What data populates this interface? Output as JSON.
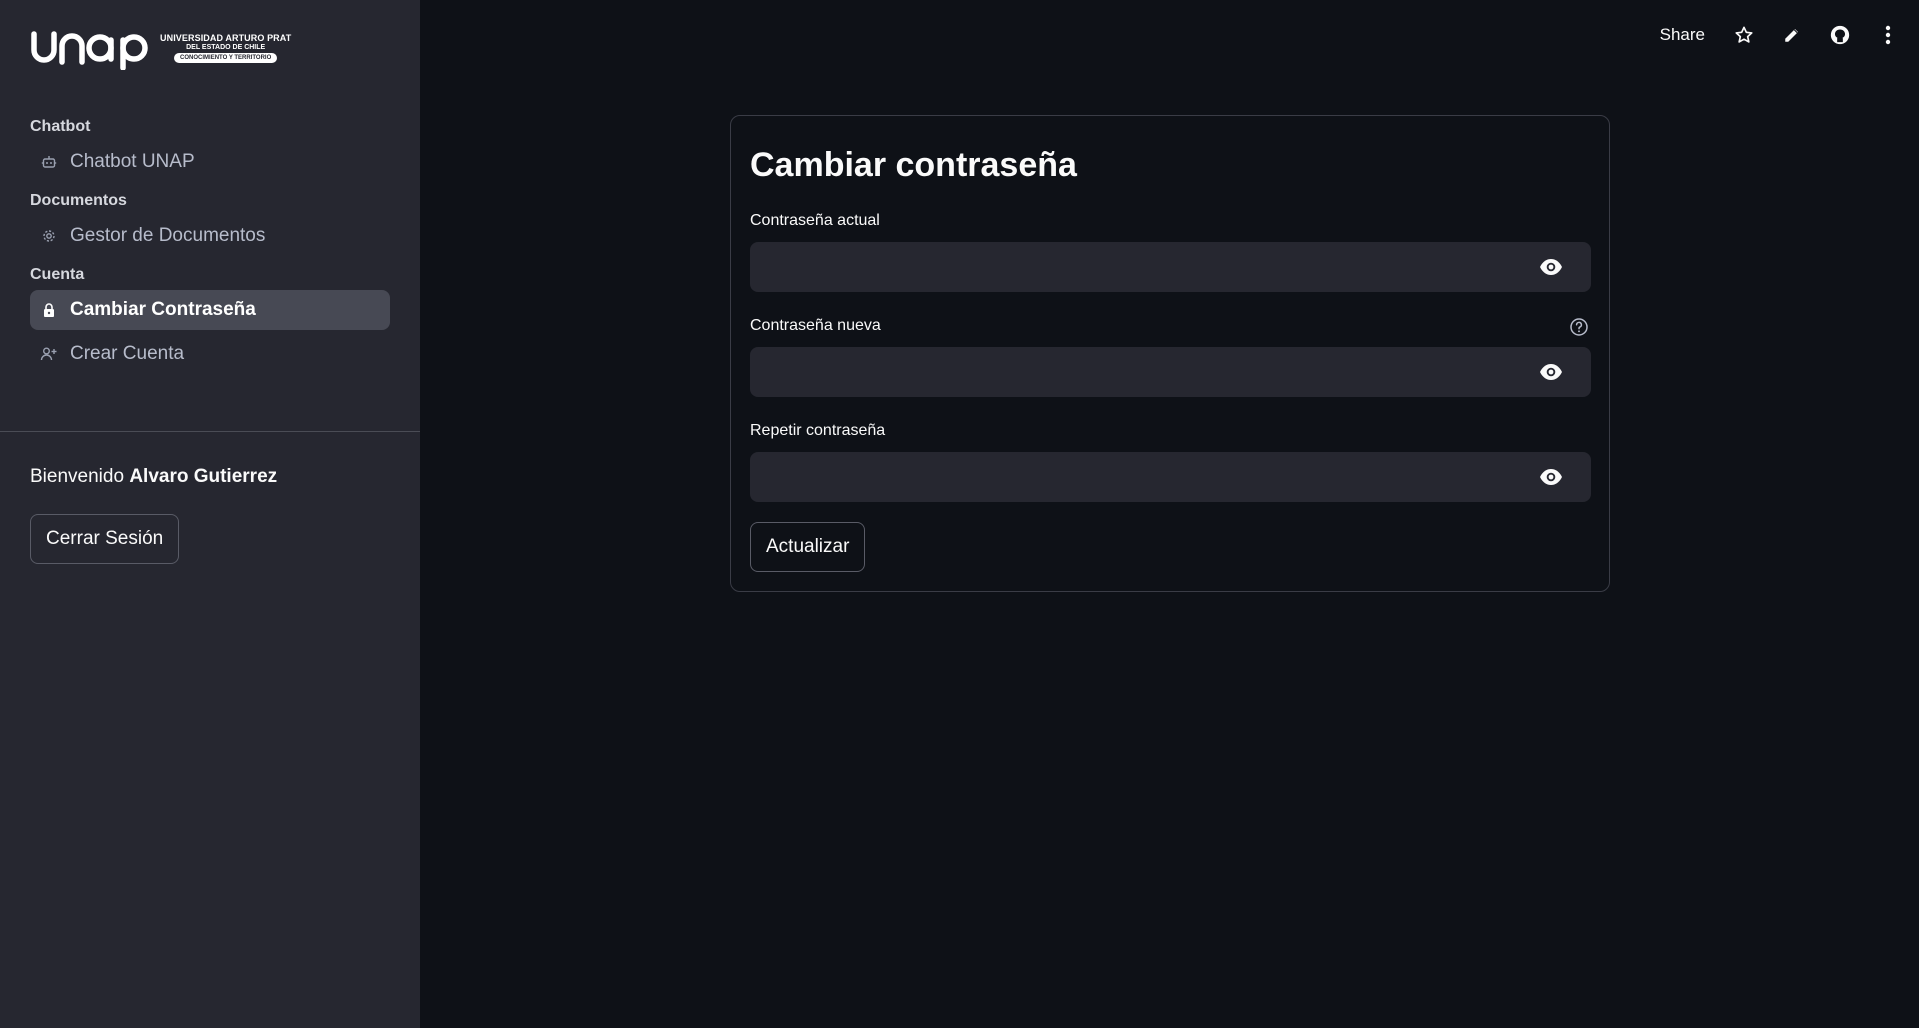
{
  "logo": {
    "mark_text": "unap",
    "line1": "UNIVERSIDAD ARTURO PRAT",
    "line2": "DEL ESTADO DE CHILE",
    "line3": "CONOCIMIENTO Y TERRITORIO"
  },
  "sidebar": {
    "sections": [
      {
        "title": "Chatbot",
        "items": [
          {
            "label": "Chatbot UNAP",
            "icon": "robot-icon",
            "active": false
          }
        ]
      },
      {
        "title": "Documentos",
        "items": [
          {
            "label": "Gestor de Documentos",
            "icon": "gear-icon",
            "active": false
          }
        ]
      },
      {
        "title": "Cuenta",
        "items": [
          {
            "label": "Cambiar Contraseña",
            "icon": "lock-icon",
            "active": true
          },
          {
            "label": "Crear Cuenta",
            "icon": "add-user-icon",
            "active": false
          }
        ]
      }
    ],
    "welcome_prefix": "Bienvenido",
    "user_name": "Alvaro Gutierrez",
    "logout_label": "Cerrar Sesión"
  },
  "toolbar": {
    "share_label": "Share",
    "icons": [
      "star-icon",
      "pencil-icon",
      "github-icon",
      "more-vertical-icon"
    ]
  },
  "form": {
    "title": "Cambiar contraseña",
    "fields": [
      {
        "label": "Contraseña actual",
        "value": ""
      },
      {
        "label": "Contraseña nueva",
        "value": "",
        "has_help": true
      },
      {
        "label": "Repetir contraseña",
        "value": ""
      }
    ],
    "submit_label": "Actualizar"
  },
  "colors": {
    "background": "#0e1117",
    "sidebar": "#262730",
    "active_item": "#474954",
    "input": "#262730",
    "text": "#fafafa"
  }
}
